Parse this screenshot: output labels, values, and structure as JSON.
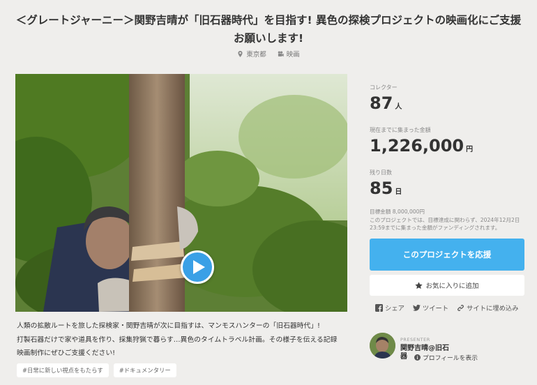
{
  "title": "＜グレートジャーニー＞関野吉晴が「旧石器時代」を目指す! 異色の探検プロジェクトの映画化にご支援お願いします!",
  "meta": {
    "location": "東京都",
    "category": "映画",
    "location_icon": "map-pin-icon",
    "category_icon": "film-camera-icon"
  },
  "video": {
    "play_icon": "play-icon"
  },
  "description": [
    "人類の拡散ルートを旅した探検家・関野吉晴が次に目指すは、マンモスハンターの「旧石器時代」!",
    "打製石器だけで家や道具を作り、採集狩猟で暮らす…異色のタイムトラベル計画。その様子を伝える記録",
    "映画制作にぜひご支援ください!"
  ],
  "tags": [
    "#日常に新しい視点をもたらす",
    "#ドキュメンタリー"
  ],
  "stats": {
    "collectors_label": "コレクター",
    "collectors_value": "87",
    "collectors_unit": "人",
    "amount_label": "現在までに集まった金額",
    "amount_value": "1,226,000",
    "amount_unit": "円",
    "days_label": "残り日数",
    "days_value": "85",
    "days_unit": "日",
    "goal_line": "目標金額 8,000,000円",
    "goal_note": "このプロジェクトでは、目標達成に関わらず、2024年12月2日23:59までに集まった金額がファンディングされます。"
  },
  "actions": {
    "back_label": "このプロジェクトを応援",
    "fav_label": "お気に入りに追加",
    "share_facebook": "シェア",
    "share_twitter": "ツイート",
    "share_embed": "サイトに埋め込み"
  },
  "presenter": {
    "label": "PRESENTER",
    "name": "関野吉晴@旧石器",
    "profile_link": "プロフィールを表示"
  },
  "colors": {
    "accent": "#44b1ee",
    "play": "#3aa0e6",
    "background": "#efeeec"
  }
}
